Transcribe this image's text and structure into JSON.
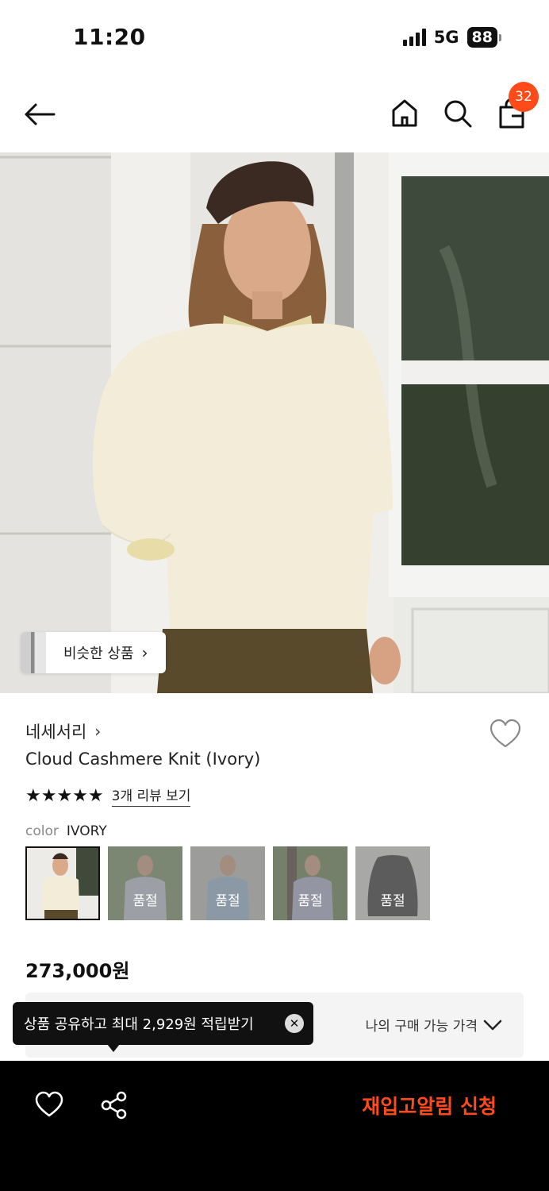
{
  "status_bar": {
    "time": "11:20",
    "network": "5G",
    "battery": "88"
  },
  "nav": {
    "back_icon": "arrow-left-icon",
    "home_icon": "home-icon",
    "search_icon": "search-icon",
    "bag_icon": "shopping-bag-icon",
    "cart_count": "32"
  },
  "hero": {
    "similar_label": "비슷한 상품",
    "chevron": "›"
  },
  "product": {
    "brand": "네세서리",
    "brand_chevron": "›",
    "name": "Cloud Cashmere Knit (Ivory)",
    "stars": "★★★★★",
    "rating": 5,
    "review_link": "3개 리뷰 보기",
    "color_label": "color",
    "color_value": "IVORY",
    "swatches": [
      {
        "label": ""
      },
      {
        "label": "품절"
      },
      {
        "label": "품절"
      },
      {
        "label": "품절"
      },
      {
        "label": "품절"
      }
    ],
    "price": "273,000원"
  },
  "my_price": {
    "label": "나의 구매 가능 가격"
  },
  "tooltip": {
    "text": "상품 공유하고 최대 2,929원 적립받기",
    "close": "✕"
  },
  "bottom_bar": {
    "heart_icon": "heart-outline-icon",
    "share_icon": "share-icon",
    "restock_label": "재입고알림 신청"
  },
  "colors": {
    "accent": "#ff4b1a",
    "bar_bg": "#000000"
  }
}
